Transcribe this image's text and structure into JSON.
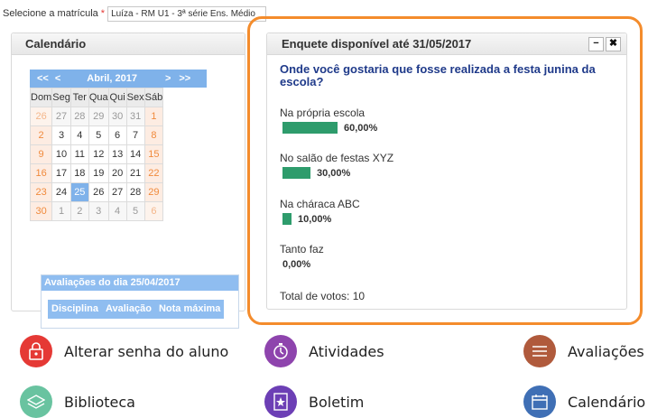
{
  "top": {
    "label": "Selecione a matrícula",
    "required": "*",
    "selected": "Luíza - RM U1 - 3ª série Ens. Médio"
  },
  "calendar": {
    "title": "Calendário",
    "nav": {
      "prev2": "<<",
      "prev": "<",
      "month": "Abril, 2017",
      "next": ">",
      "next2": ">>"
    },
    "weekdays": [
      "Dom",
      "Seg",
      "Ter",
      "Qua",
      "Qui",
      "Sex",
      "Sáb"
    ],
    "weeks": [
      [
        "26",
        "27",
        "28",
        "29",
        "30",
        "31",
        "1"
      ],
      [
        "2",
        "3",
        "4",
        "5",
        "6",
        "7",
        "8"
      ],
      [
        "9",
        "10",
        "11",
        "12",
        "13",
        "14",
        "15"
      ],
      [
        "16",
        "17",
        "18",
        "19",
        "20",
        "21",
        "22"
      ],
      [
        "23",
        "24",
        "25",
        "26",
        "27",
        "28",
        "29"
      ],
      [
        "30",
        "1",
        "2",
        "3",
        "4",
        "5",
        "6"
      ]
    ],
    "evaluations": {
      "title": "Avaliações do dia 25/04/2017",
      "columns": [
        "Disciplina",
        "Avaliação",
        "Nota máxima"
      ]
    }
  },
  "poll": {
    "title": "Enquete disponível até 31/05/2017",
    "minimize": "−",
    "close": "✖",
    "question": "Onde você gostaria que fosse realizada a festa junina da escola?",
    "options": [
      {
        "label": "Na própria escola",
        "percent": 60,
        "percent_label": "60,00%"
      },
      {
        "label": "No salão de festas XYZ",
        "percent": 30,
        "percent_label": "30,00%"
      },
      {
        "label": "Na cháraca ABC",
        "percent": 10,
        "percent_label": "10,00%"
      },
      {
        "label": "Tanto faz",
        "percent": 0,
        "percent_label": "0,00%"
      }
    ],
    "total": "Total de votos: 10"
  },
  "shortcuts": [
    {
      "label": "Alterar senha do aluno",
      "icon": "lock-icon",
      "color": "#e53935"
    },
    {
      "label": "Atividades",
      "icon": "timer-icon",
      "color": "#8e44ad"
    },
    {
      "label": "Avaliações",
      "icon": "list-icon",
      "color": "#b05a3c"
    },
    {
      "label": "Biblioteca",
      "icon": "layers-icon",
      "color": "#69c3a0"
    },
    {
      "label": "Boletim",
      "icon": "report-icon",
      "color": "#6c3fb5"
    },
    {
      "label": "Calendário",
      "icon": "calendar-icon",
      "color": "#3f6fb5"
    }
  ],
  "colors": {
    "accent": "#7fb2ea",
    "highlight": "#f48c2c",
    "bar": "#2e9c6c"
  }
}
